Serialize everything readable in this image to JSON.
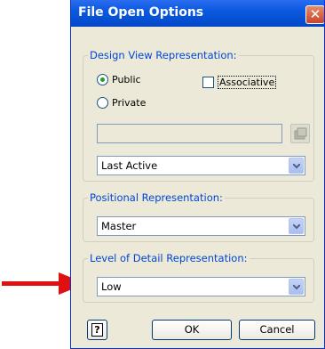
{
  "dialog": {
    "title": "File Open Options",
    "close_icon": "close-icon"
  },
  "design_view": {
    "legend": "Design View Representation:",
    "radio_public": "Public",
    "radio_private": "Private",
    "selected": "Public",
    "associative_label": "Associative",
    "associative_checked": false,
    "path_value": "",
    "browse_icon": "folder-browse-icon",
    "selected_view": "Last Active"
  },
  "positional": {
    "legend": "Positional Representation:",
    "selected": "Master"
  },
  "level_of_detail": {
    "legend": "Level of Detail Representation:",
    "selected": "Low"
  },
  "buttons": {
    "help_glyph": "?",
    "ok": "OK",
    "cancel": "Cancel"
  },
  "annotation": {
    "arrow_color": "#e01010"
  }
}
